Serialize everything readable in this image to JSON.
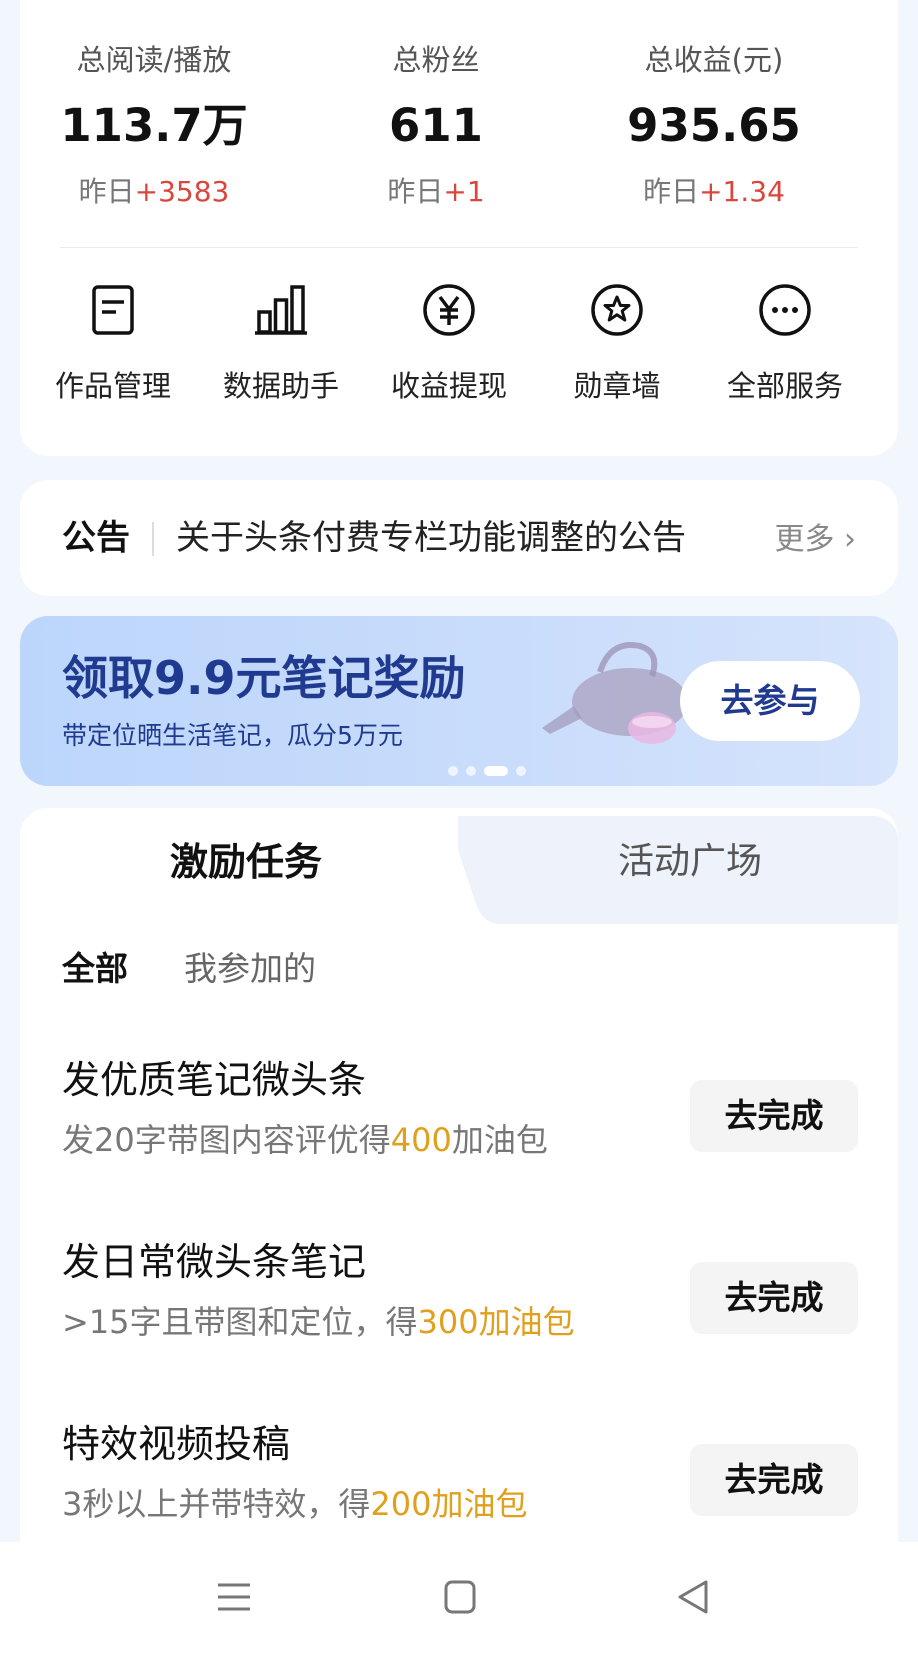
{
  "stats": [
    {
      "label": "总阅读/播放",
      "value": "113.7万",
      "delta_prefix": "昨日",
      "delta": "+3583"
    },
    {
      "label": "总粉丝",
      "value": "611",
      "delta_prefix": "昨日",
      "delta": "+1"
    },
    {
      "label": "总收益(元)",
      "value": "935.65",
      "delta_prefix": "昨日",
      "delta": "+1.34"
    }
  ],
  "services": [
    {
      "label": "作品管理",
      "icon": "document-icon"
    },
    {
      "label": "数据助手",
      "icon": "bar-chart-icon"
    },
    {
      "label": "收益提现",
      "icon": "yen-coin-icon"
    },
    {
      "label": "勋章墙",
      "icon": "medal-star-icon"
    },
    {
      "label": "全部服务",
      "icon": "more-dots-icon"
    }
  ],
  "notice": {
    "tag": "公告",
    "text": "关于头条付费专栏功能调整的公告",
    "more": "更多"
  },
  "banner": {
    "title": "领取9.9元笔记奖励",
    "subtitle": "带定位晒生活笔记，瓜分5万元",
    "button": "去参与",
    "slides": 4,
    "active_slide": 3
  },
  "tabs": {
    "active": "激励任务",
    "inactive": "活动广场"
  },
  "subtabs": {
    "all": "全部",
    "joined": "我参加的"
  },
  "tasks": [
    {
      "title": "发优质笔记微头条",
      "desc_before": "发20字带图内容评优得",
      "highlight": "400",
      "desc_after": "加油包",
      "button": "去完成"
    },
    {
      "title": "发日常微头条笔记",
      "desc_before": ">15字且带图和定位，得",
      "highlight": "300加油包",
      "desc_after": "",
      "button": "去完成"
    },
    {
      "title": "特效视频投稿",
      "desc_before": "3秒以上并带特效，得",
      "highlight": "200加油包",
      "desc_after": "",
      "button": "去完成"
    }
  ],
  "colors": {
    "accent_red": "#d9473c",
    "highlight_gold": "#e0a01e",
    "banner_blue": "#1f3a8f"
  }
}
